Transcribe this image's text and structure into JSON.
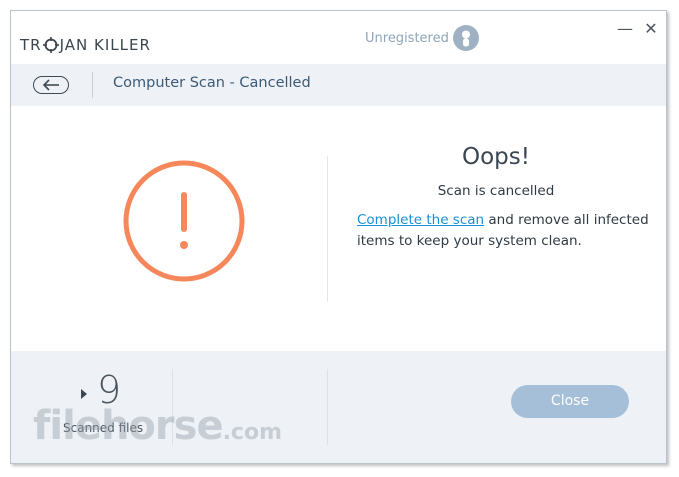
{
  "titlebar": {
    "logo_part1": "TR",
    "logo_part2": "JAN KILLER",
    "registration_status": "Unregistered",
    "minimize_glyph": "—",
    "close_glyph": "✕"
  },
  "header": {
    "title": "Computer Scan - Cancelled"
  },
  "main": {
    "heading": "Oops!",
    "subtitle": "Scan is cancelled",
    "link_text": "Complete the scan",
    "message_rest": " and remove all infected items to keep your system clean.",
    "warning_color": "#f6875a"
  },
  "footer": {
    "scanned_count": "9",
    "scanned_label": "Scanned files",
    "close_label": "Close"
  },
  "watermark": {
    "main": "filehorse",
    "suffix": ".com"
  },
  "colors": {
    "accent_link": "#1a8fd4",
    "header_bg": "#eef2f6",
    "close_button": "#a6bfd8",
    "title_text": "#3d5a78"
  }
}
